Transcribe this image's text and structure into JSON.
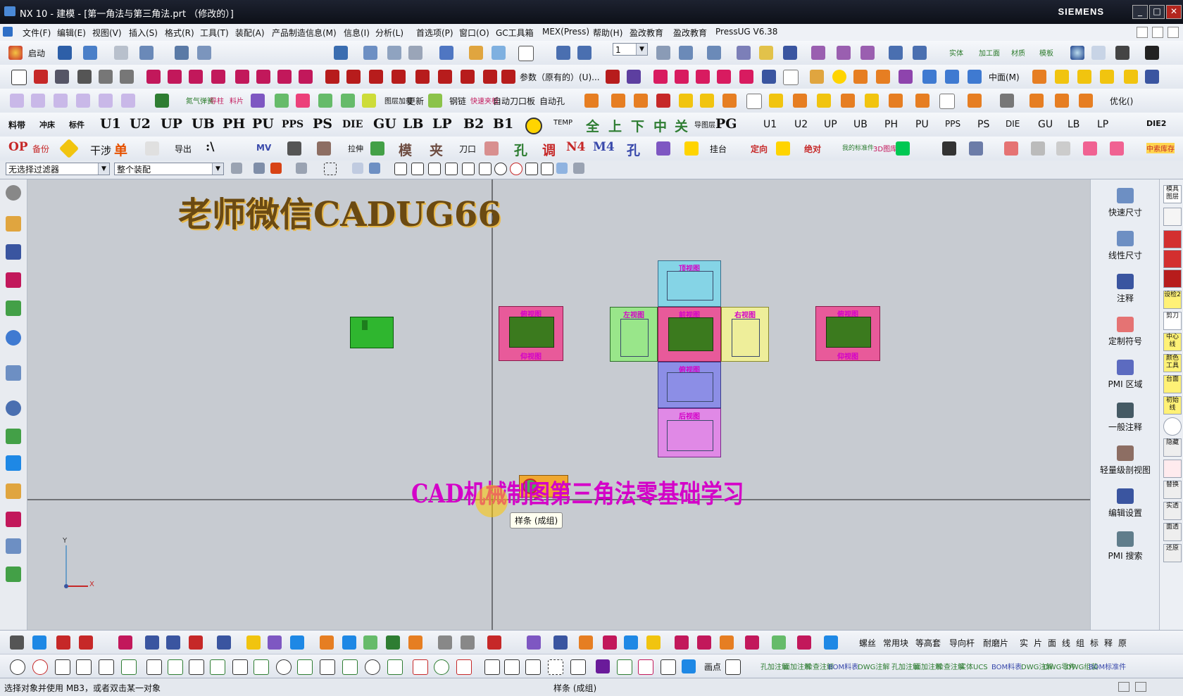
{
  "window": {
    "title": "NX 10 - 建模 - [第一角法与第三角法.prt （修改的）]",
    "brand": "SIEMENS",
    "controls": [
      "_",
      "□",
      "✕"
    ]
  },
  "menu": [
    "文件(F)",
    "编辑(E)",
    "视图(V)",
    "插入(S)",
    "格式(R)",
    "工具(T)",
    "装配(A)",
    "产品制造信息(M)",
    "信息(I)",
    "分析(L)",
    "首选项(P)",
    "窗口(O)",
    "GC工具箱",
    "MEX(Press)",
    "帮助(H)",
    "盈改教育",
    "盈改教育",
    "PressUG V6.38"
  ],
  "toolbar1": {
    "start": "启动",
    "zoom_value": "1",
    "labels": [
      "实体",
      "加工面",
      "材质",
      "模板"
    ]
  },
  "toolbar2": {
    "param_label": "参数（原有的）(U)...",
    "mid_plane": "中面(M)"
  },
  "toolbar3": {
    "labels": [
      "氮气弹簧",
      "导柱",
      "料片",
      "图层加载",
      "更新",
      "钢链",
      "快速夹板",
      "自动刀口板",
      "自动孔",
      "优化()"
    ]
  },
  "toolbar4": {
    "labels": [
      "料带",
      "冲床",
      "标件",
      "U1",
      "U2",
      "UP",
      "UB",
      "PH",
      "PU",
      "PPS",
      "PS",
      "DIE",
      "GU",
      "LB",
      "LP",
      "B2",
      "B1",
      "TEMP",
      "全",
      "上",
      "下",
      "中",
      "关",
      "导图层",
      "PG",
      "U1",
      "U2",
      "UP",
      "UB",
      "PH",
      "PU",
      "PPS",
      "PS",
      "DIE",
      "GU",
      "LB",
      "LP",
      "DIE2"
    ]
  },
  "toolbar5": {
    "labels": [
      "OP",
      "备份",
      "干涉",
      "单",
      "导出",
      ":\\",
      "MV",
      "拉伸",
      "模",
      "夹",
      "刀口",
      "孔",
      "调",
      "N4",
      "M4",
      "孔",
      "挂台",
      "定向",
      "绝对",
      "我的标准件",
      "3D图库",
      "中索库存"
    ]
  },
  "filter": {
    "selection_filter": "无选择过滤器",
    "assembly_scope": "整个装配"
  },
  "canvas": {
    "watermark_top": "老师微信CADUG66",
    "caption": "CAD机械制图第三角法零基础学习",
    "tooltip": "样条 (成组)",
    "views": {
      "top": "顶视图",
      "left": "左视图",
      "front": "前视图",
      "right": "右视图",
      "bottom": "俯视图",
      "back": "后视图",
      "side_left_top": "俯视图",
      "side_left_bottom": "仰视图",
      "side_right_top": "俯视图",
      "side_right_bottom": "仰视图"
    },
    "axis_x": "X",
    "axis_y": "Y"
  },
  "right_panel": [
    "快速尺寸",
    "线性尺寸",
    "注释",
    "定制符号",
    "PMI 区域",
    "一般注释",
    "轻量级剖视图",
    "编辑设置",
    "PMI 搜索"
  ],
  "right_strip": [
    "模具图层",
    "设检2",
    "剪刀",
    "中心线",
    "颜色工具",
    "台面",
    "初始线",
    "隐藏",
    "替换",
    "实透",
    "面透",
    "还原"
  ],
  "bottom_toolbar1": {
    "labels": [
      "螺丝",
      "常用块",
      "等高套",
      "导向杆",
      "耐磨片",
      "实",
      "片",
      "面",
      "线",
      "组",
      "标",
      "释",
      "原"
    ]
  },
  "bottom_toolbar2": {
    "labels": [
      "画点",
      "孔加注解",
      "面加注解",
      "检查注解",
      "BOM料表",
      "DWG注解",
      "孔加注解",
      "面加注解",
      "检查注解",
      "实体UCS",
      "BOM料表",
      "DWG注解",
      "DWG零件",
      "DWG组装",
      "BOM标准件"
    ]
  },
  "status": {
    "prompt": "选择对象并使用 MB3，或者双击某一对象",
    "center": "样条 (成组)"
  }
}
